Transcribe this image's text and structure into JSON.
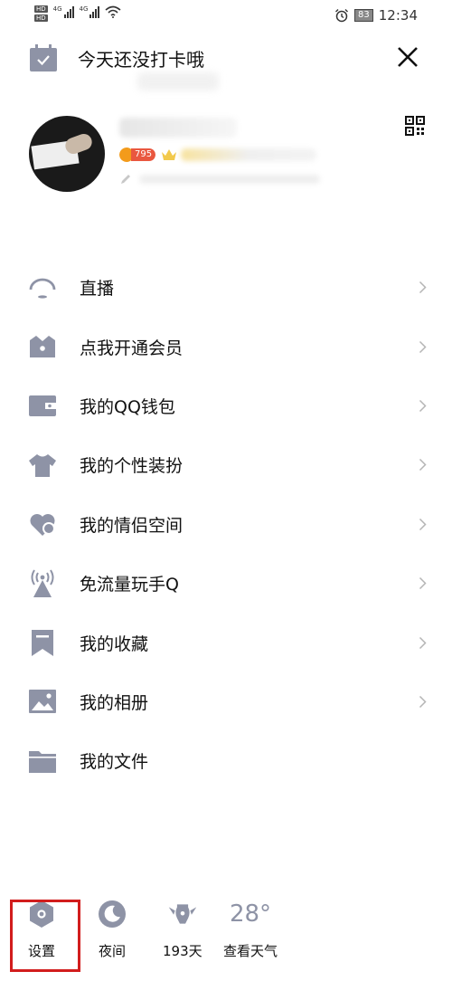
{
  "status_bar": {
    "hd1": "HD",
    "hd2": "HD",
    "signal1_label": "4G",
    "signal2_label": "4G",
    "battery": "83",
    "time": "12:34",
    "icons": [
      "signal-icon",
      "wifi-icon",
      "alarm-icon",
      "battery-icon"
    ]
  },
  "header": {
    "checkin_text": "今天还没打卡哦",
    "icons": [
      "calendar-check-icon",
      "close-icon"
    ]
  },
  "profile": {
    "level_badge": "795",
    "icons": [
      "avatar",
      "crown-icon",
      "pen-icon",
      "qr-code-icon"
    ]
  },
  "menu": {
    "items": [
      {
        "label": "直播",
        "icon": "live-icon",
        "chevron": true
      },
      {
        "label": "点我开通会员",
        "icon": "vip-icon",
        "chevron": true
      },
      {
        "label": "我的QQ钱包",
        "icon": "wallet-icon",
        "chevron": true
      },
      {
        "label": "我的个性装扮",
        "icon": "tshirt-icon",
        "chevron": true
      },
      {
        "label": "我的情侣空间",
        "icon": "couple-heart-icon",
        "chevron": true
      },
      {
        "label": "免流量玩手Q",
        "icon": "signal-tower-icon",
        "chevron": true
      },
      {
        "label": "我的收藏",
        "icon": "bookmark-icon",
        "chevron": true
      },
      {
        "label": "我的相册",
        "icon": "photo-icon",
        "chevron": true
      },
      {
        "label": "我的文件",
        "icon": "folder-icon",
        "chevron": false
      }
    ]
  },
  "bottom_bar": {
    "settings_label": "设置",
    "night_label": "夜间",
    "days_label": "193天",
    "weather_temp": "28°",
    "weather_label": "查看天气",
    "highlight_color": "#d21d1d",
    "icon_color": "#8e93a6"
  }
}
